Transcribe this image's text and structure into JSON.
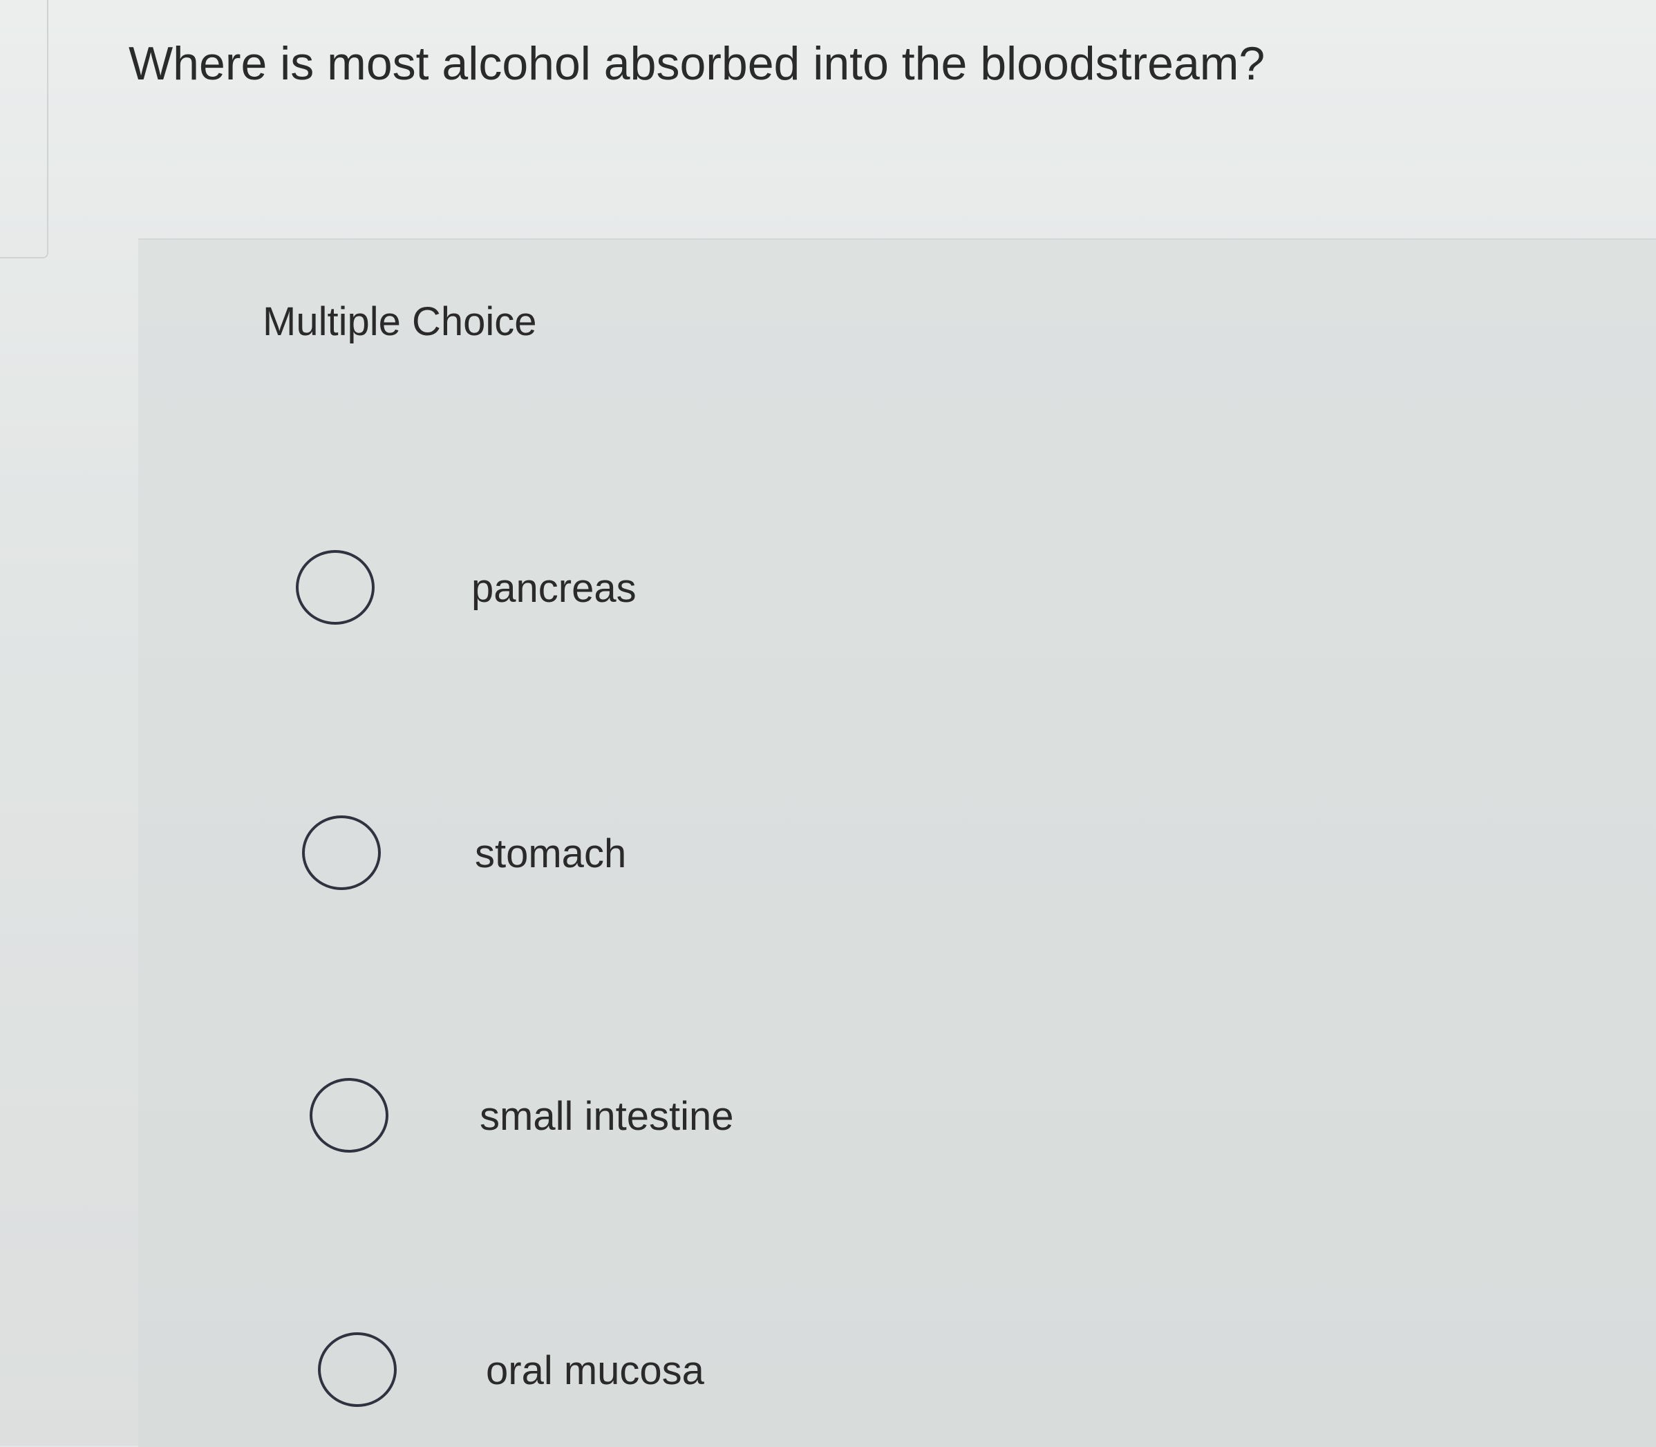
{
  "question": {
    "text": "Where is most alcohol absorbed into the bloodstream?"
  },
  "answer_section": {
    "label": "Multiple Choice",
    "choices": [
      {
        "label": "pancreas",
        "selected": false
      },
      {
        "label": "stomach",
        "selected": false
      },
      {
        "label": "small intestine",
        "selected": false
      },
      {
        "label": "oral mucosa",
        "selected": false
      }
    ]
  },
  "colors": {
    "background": "#e3e6e6",
    "text": "#2a2a2a",
    "radio_border": "#2f3340"
  }
}
